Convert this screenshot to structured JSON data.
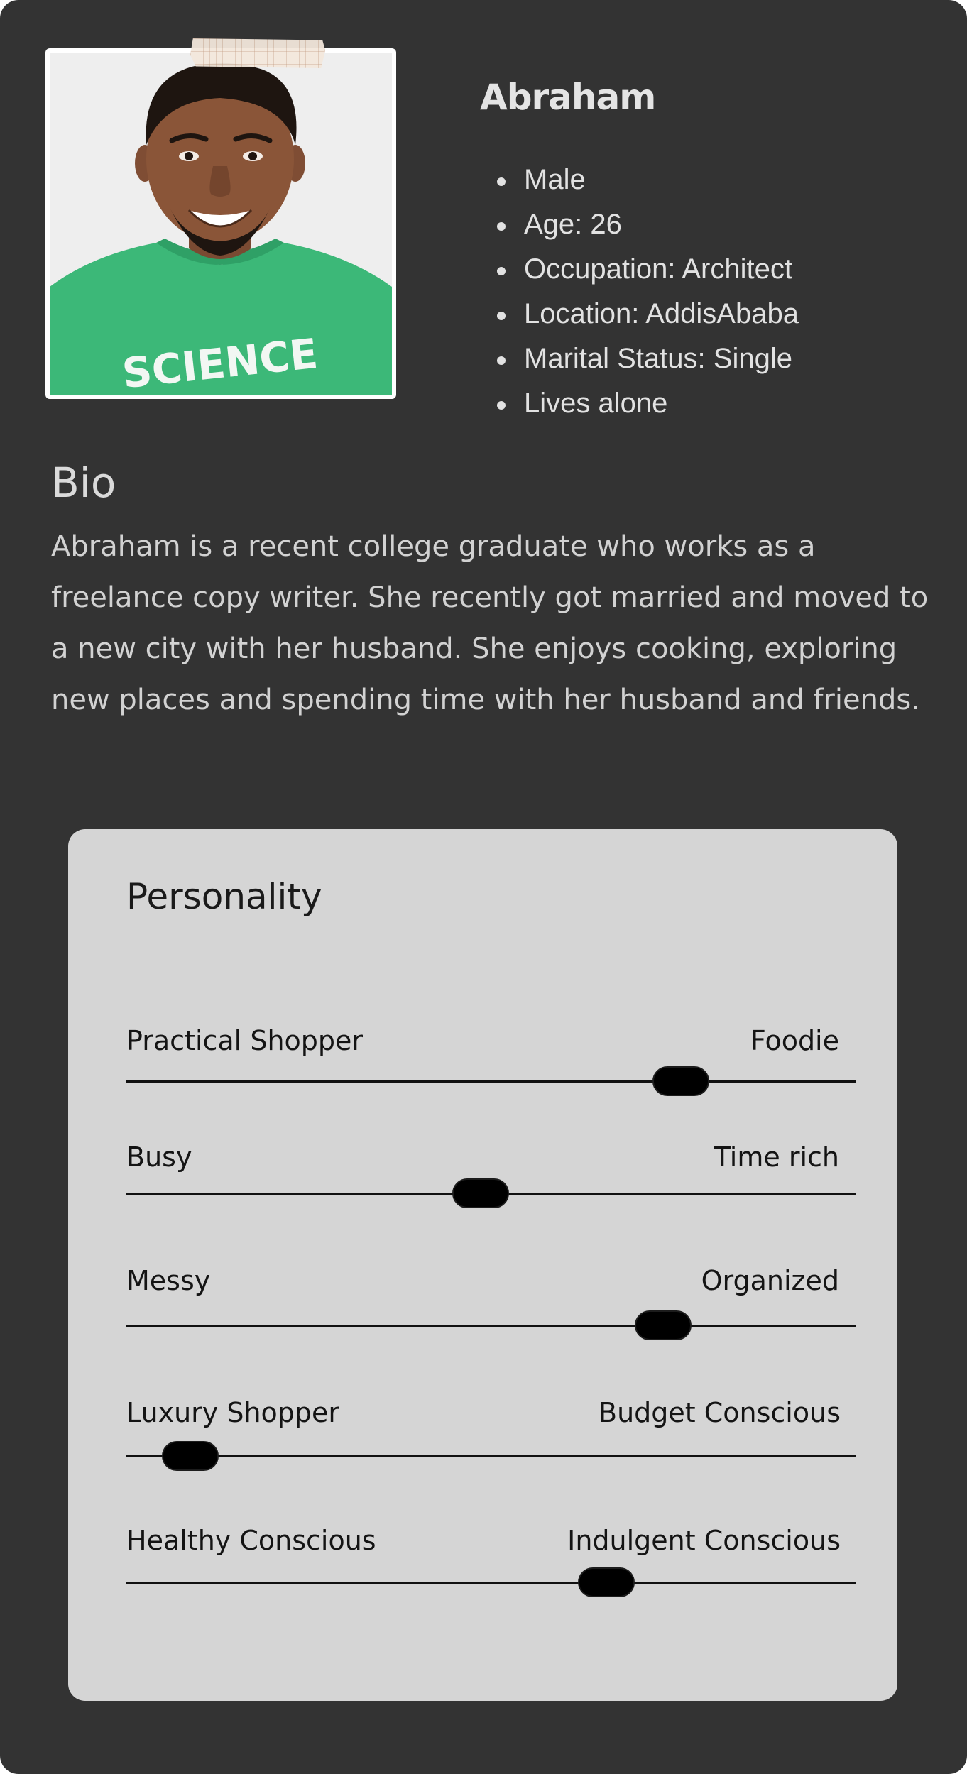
{
  "profile": {
    "name": "Abraham",
    "photo_label": "SCIENCE",
    "facts": [
      "Male",
      "Age: 26",
      "Occupation: Architect",
      "Location: AddisAbaba",
      "Marital Status: Single",
      "Lives alone"
    ]
  },
  "bio": {
    "title": "Bio",
    "text": "Abraham is a recent college graduate who works as a freelance copy writer. She recently got married and moved to a new city with her husband. She enjoys cooking, exploring new places and spending time with her husband and friends."
  },
  "personality": {
    "title": "Personality",
    "traits": [
      {
        "left": "Practical Shopper",
        "right": "Foodie",
        "value": 0.76
      },
      {
        "left": "Busy",
        "right": "Time rich",
        "value": 0.485
      },
      {
        "left": "Messy",
        "right": "Organized",
        "value": 0.735
      },
      {
        "left": "Luxury Shopper",
        "right": "Budget Conscious",
        "value": 0.088
      },
      {
        "left": "Healthy Conscious",
        "right": "Indulgent Conscious",
        "value": 0.658
      }
    ]
  },
  "colors": {
    "background": "#333333",
    "panel": "#d5d5d5",
    "shirt": "#3cb878",
    "thumb": "#000000"
  }
}
